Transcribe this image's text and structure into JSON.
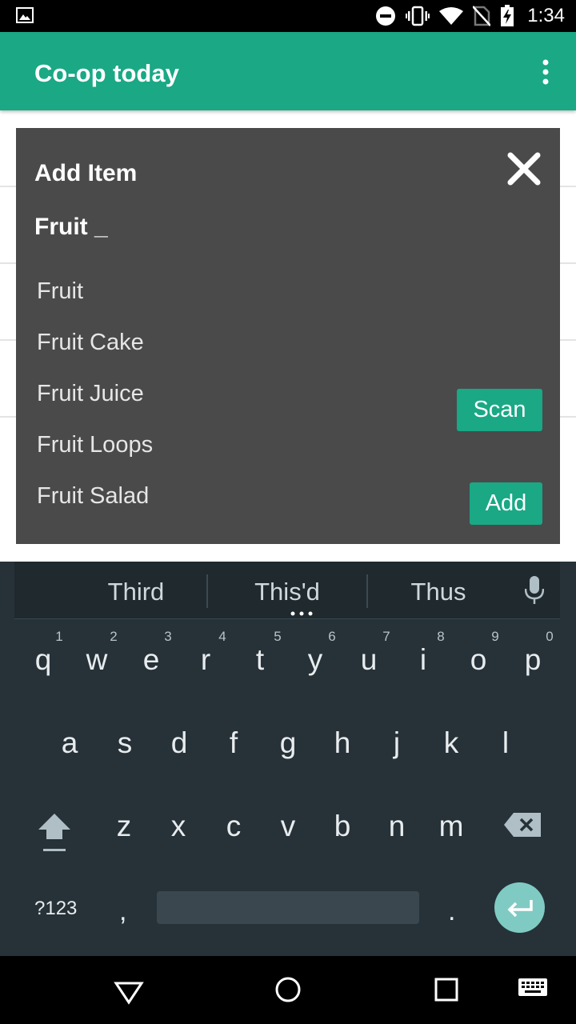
{
  "status_bar": {
    "time": "1:34",
    "icons": [
      "gallery-notification-icon",
      "do-not-disturb-icon",
      "vibrate-icon",
      "wifi-icon",
      "no-sim-icon",
      "battery-charging-icon"
    ]
  },
  "app_bar": {
    "title": "Co-op today",
    "menu_icon": "overflow-menu-icon"
  },
  "dialog": {
    "title": "Add Item",
    "input_value": "Fruit _",
    "suggestions": [
      "Fruit",
      "Fruit Cake",
      "Fruit Juice",
      "Fruit Loops",
      "Fruit Salad"
    ],
    "scan_label": "Scan",
    "add_label": "Add",
    "close_icon": "close-icon"
  },
  "keyboard": {
    "suggestions": [
      "Third",
      "This'd",
      "Thus"
    ],
    "row1": [
      "q",
      "w",
      "e",
      "r",
      "t",
      "y",
      "u",
      "i",
      "o",
      "p"
    ],
    "row1_hints": [
      "1",
      "2",
      "3",
      "4",
      "5",
      "6",
      "7",
      "8",
      "9",
      "0"
    ],
    "row2": [
      "a",
      "s",
      "d",
      "f",
      "g",
      "h",
      "j",
      "k",
      "l"
    ],
    "row3": [
      "z",
      "x",
      "c",
      "v",
      "b",
      "n",
      "m"
    ],
    "symbols_label": "?123",
    "comma_label": ",",
    "period_label": ".",
    "colors": {
      "background": "#263238",
      "enter": "#7fcbc3"
    }
  },
  "nav_bar": {
    "icons": [
      "back-icon",
      "home-icon",
      "recents-icon",
      "keyboard-switch-icon"
    ]
  },
  "colors": {
    "accent": "#1aa885",
    "dialog_background": "#4a4a4a"
  }
}
